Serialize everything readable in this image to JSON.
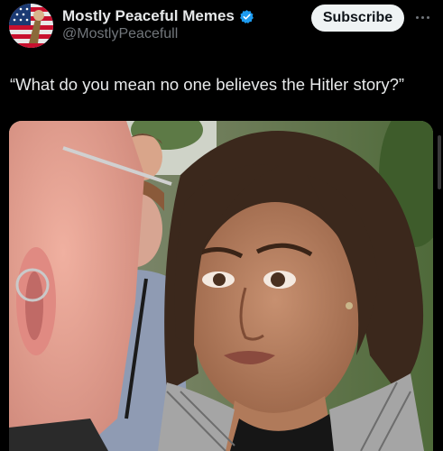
{
  "post": {
    "author": {
      "display_name": "Mostly Peaceful Memes",
      "handle": "@MostlyPeacefull",
      "verified": true,
      "avatar_icon": "american-flag-avatar-icon"
    },
    "subscribe_label": "Subscribe",
    "more_icon": "more-horizontal-icon",
    "text": "“What do you mean no one believes the Hitler story?”",
    "media": {
      "type": "photo"
    }
  },
  "colors": {
    "background": "#000000",
    "primary_text": "#e7e9ea",
    "secondary_text": "#71767b",
    "verified_badge": "#1d9bf0",
    "subscribe_bg": "#eff3f4",
    "subscribe_text": "#0f1419"
  }
}
